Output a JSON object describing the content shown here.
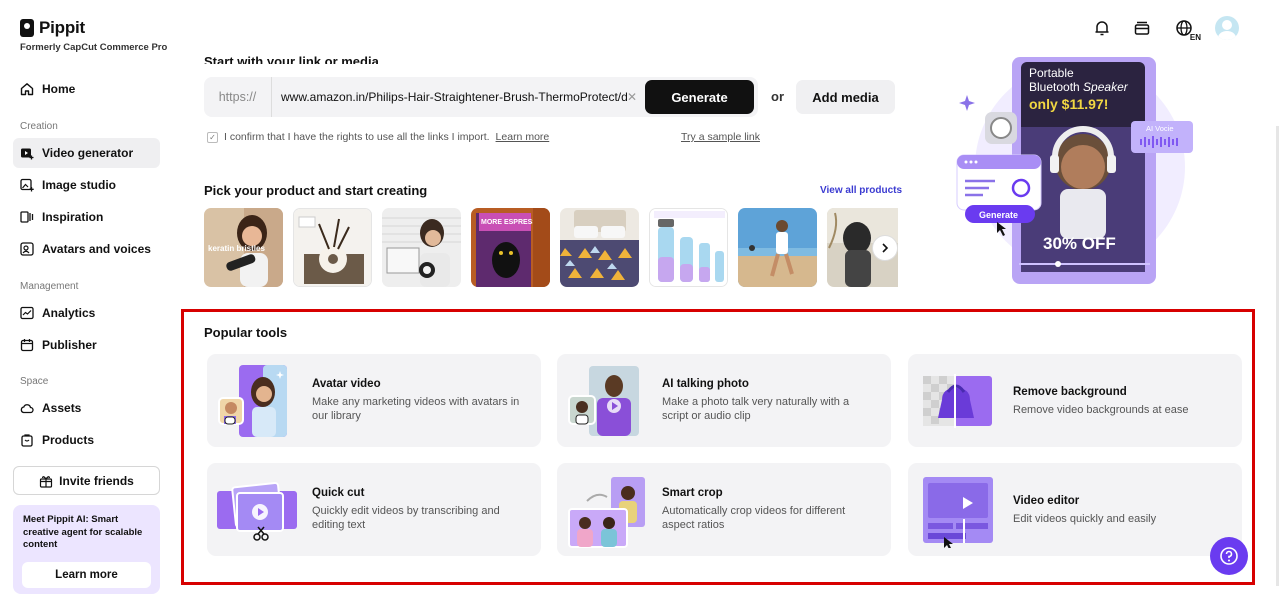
{
  "brand": {
    "name": "Pippit",
    "subtitle": "Formerly CapCut Commerce Pro"
  },
  "sidebar": {
    "home": "Home",
    "creation_label": "Creation",
    "creation_items": [
      {
        "label": "Video generator",
        "icon": "video-plus-icon",
        "active": true
      },
      {
        "label": "Image studio",
        "icon": "image-plus-icon",
        "active": false
      },
      {
        "label": "Inspiration",
        "icon": "inspiration-icon",
        "active": false
      },
      {
        "label": "Avatars and voices",
        "icon": "avatar-voice-icon",
        "active": false
      }
    ],
    "management_label": "Management",
    "management_items": [
      {
        "label": "Analytics",
        "icon": "analytics-icon"
      },
      {
        "label": "Publisher",
        "icon": "calendar-icon"
      }
    ],
    "space_label": "Space",
    "space_items": [
      {
        "label": "Assets",
        "icon": "cloud-icon"
      },
      {
        "label": "Products",
        "icon": "bag-icon"
      }
    ],
    "invite": "Invite friends",
    "promo_text": "Meet Pippit AI: Smart creative agent for scalable content",
    "promo_button": "Learn more"
  },
  "header": {
    "language": "EN"
  },
  "start": {
    "title": "Start with your link or media",
    "url_prefix": "https://",
    "url_value": "www.amazon.in/Philips-Hair-Straightener-Brush-ThermoProtect/dp",
    "generate_label": "Generate",
    "or_label": "or",
    "add_media_label": "Add media",
    "confirm_text": "I confirm that I have the rights to use all the links I import.",
    "learn_more": "Learn more",
    "try_sample": "Try a sample link"
  },
  "pick": {
    "title": "Pick your product and start creating",
    "view_all": "View all products",
    "thumb_texts": [
      "keratin bristles",
      "MORE ESPRESSO"
    ]
  },
  "hero": {
    "line1": "Portable",
    "line2a": "Bluetooth ",
    "line2b": "Speaker",
    "price": "only $11.97!",
    "ai_voice": "AI Vocie",
    "generate": "Generate",
    "discount": "30% OFF"
  },
  "popular": {
    "title": "Popular tools",
    "tools": [
      {
        "name": "Avatar video",
        "desc": "Make any marketing videos with avatars in our library"
      },
      {
        "name": "AI talking photo",
        "desc": "Make a photo talk very naturally with a script or audio clip"
      },
      {
        "name": "Remove background",
        "desc": "Remove video backgrounds at ease"
      },
      {
        "name": "Quick cut",
        "desc": "Quickly edit videos by transcribing and editing text"
      },
      {
        "name": "Smart crop",
        "desc": "Automatically crop videos for different aspect ratios"
      },
      {
        "name": "Video editor",
        "desc": "Edit videos quickly and easily"
      }
    ]
  },
  "colors": {
    "accent": "#6a3bf0",
    "highlight_frame": "#d70000",
    "card_bg": "#f3f3f5"
  }
}
